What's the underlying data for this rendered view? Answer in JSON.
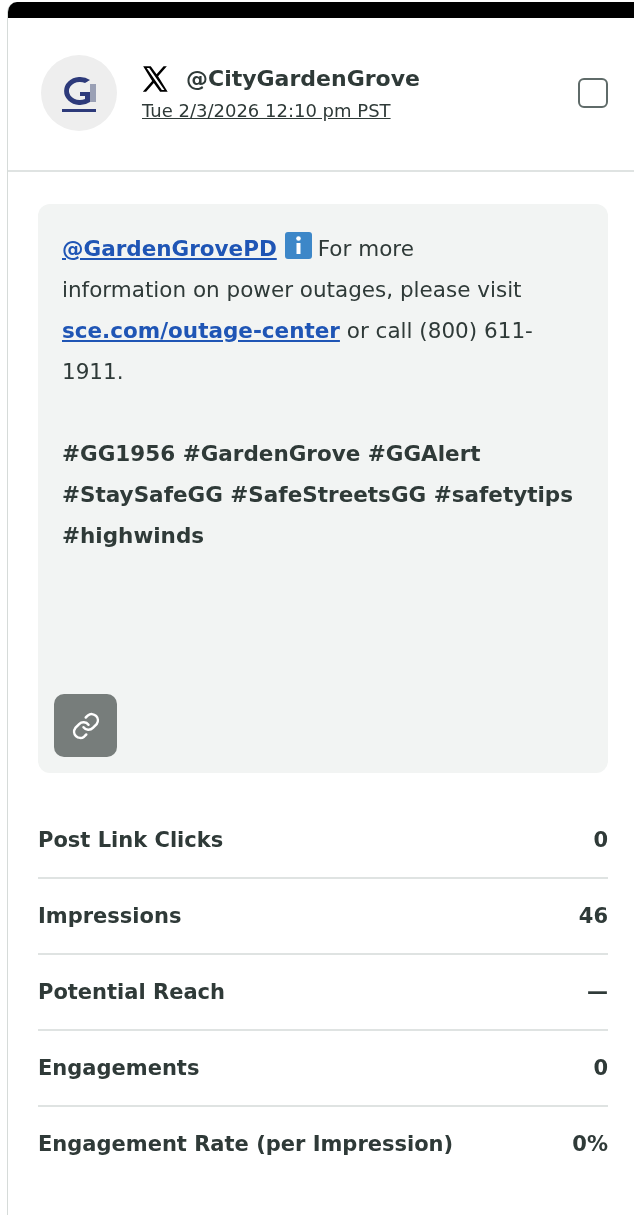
{
  "account": {
    "handle": "@CityGardenGrove",
    "timestamp": "Tue 2/3/2026 12:10 pm PST",
    "selected": false
  },
  "post": {
    "mention": "@GardenGrovePD",
    "text_first_line": "For more",
    "text_before_link": "information on power outages, please visit",
    "link": "sce.com/outage-center",
    "text_after_link": "or call (800) 611-1911.",
    "hashtags": "#GG1956 #GardenGrove #GGAlert #StaySafeGG #SafeStreetsGG #safetytips #highwinds"
  },
  "metrics": [
    {
      "label": "Post Link Clicks",
      "value": "0"
    },
    {
      "label": "Impressions",
      "value": "46"
    },
    {
      "label": "Potential Reach",
      "value": "—"
    },
    {
      "label": "Engagements",
      "value": "0"
    },
    {
      "label": "Engagement Rate (per Impression)",
      "value": "0%"
    }
  ]
}
